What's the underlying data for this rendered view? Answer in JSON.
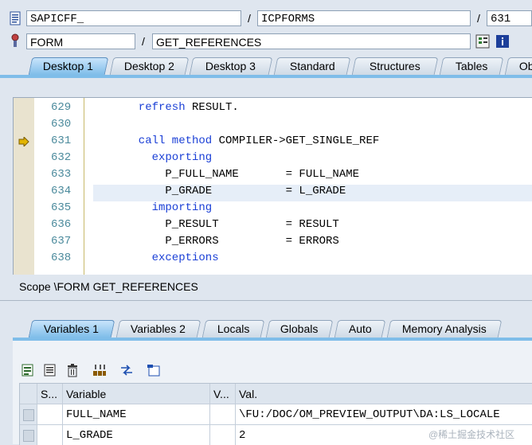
{
  "header": {
    "program": "SAPICFF_",
    "include": "ICPFORMS",
    "line": "631",
    "event_type": "FORM",
    "event_name": "GET_REFERENCES",
    "sep": "/"
  },
  "tabs": [
    "Desktop 1",
    "Desktop 2",
    "Desktop 3",
    "Standard",
    "Structures",
    "Tables",
    "Ob"
  ],
  "code": {
    "lines": [
      {
        "num": "629",
        "indent": "  ",
        "kw1": "refresh",
        "text1": " RESULT.",
        "kw2": "",
        "text2": ""
      },
      {
        "num": "630",
        "indent": "",
        "kw1": "",
        "text1": "",
        "kw2": "",
        "text2": ""
      },
      {
        "num": "631",
        "indent": "  ",
        "kw1": "call method",
        "text1": " COMPILER->GET_SINGLE_REF",
        "kw2": "",
        "text2": ""
      },
      {
        "num": "632",
        "indent": "    ",
        "kw1": "exporting",
        "text1": "",
        "kw2": "",
        "text2": ""
      },
      {
        "num": "633",
        "indent": "      ",
        "kw1": "",
        "text1": "P_FULL_NAME       = FULL_NAME",
        "kw2": "",
        "text2": ""
      },
      {
        "num": "634",
        "indent": "      ",
        "kw1": "",
        "text1": "P_GRADE           = L_GRADE",
        "kw2": "",
        "text2": ""
      },
      {
        "num": "635",
        "indent": "    ",
        "kw1": "importing",
        "text1": "",
        "kw2": "",
        "text2": ""
      },
      {
        "num": "636",
        "indent": "      ",
        "kw1": "",
        "text1": "P_RESULT          = RESULT",
        "kw2": "",
        "text2": ""
      },
      {
        "num": "637",
        "indent": "      ",
        "kw1": "",
        "text1": "P_ERRORS          = ERRORS",
        "kw2": "",
        "text2": ""
      },
      {
        "num": "638",
        "indent": "    ",
        "kw1": "exceptions",
        "text1": "",
        "kw2": "",
        "text2": ""
      }
    ]
  },
  "scope": "Scope \\FORM GET_REFERENCES",
  "var_tabs": [
    "Variables 1",
    "Variables 2",
    "Locals",
    "Globals",
    "Auto",
    "Memory Analysis"
  ],
  "grid": {
    "columns": [
      "S...",
      "Variable",
      "V...",
      "Val."
    ],
    "rows": [
      {
        "variable": "FULL_NAME",
        "value": "\\FU:/DOC/OM_PREVIEW_OUTPUT\\DA:LS_LOCALE"
      },
      {
        "variable": "L_GRADE",
        "value": "2"
      }
    ]
  },
  "watermark": "@稀土掘金技术社区",
  "colors": {
    "keyword": "#1a3fd6",
    "active_tab": "#7fbde9",
    "highlight_line": "#e6eef8"
  }
}
